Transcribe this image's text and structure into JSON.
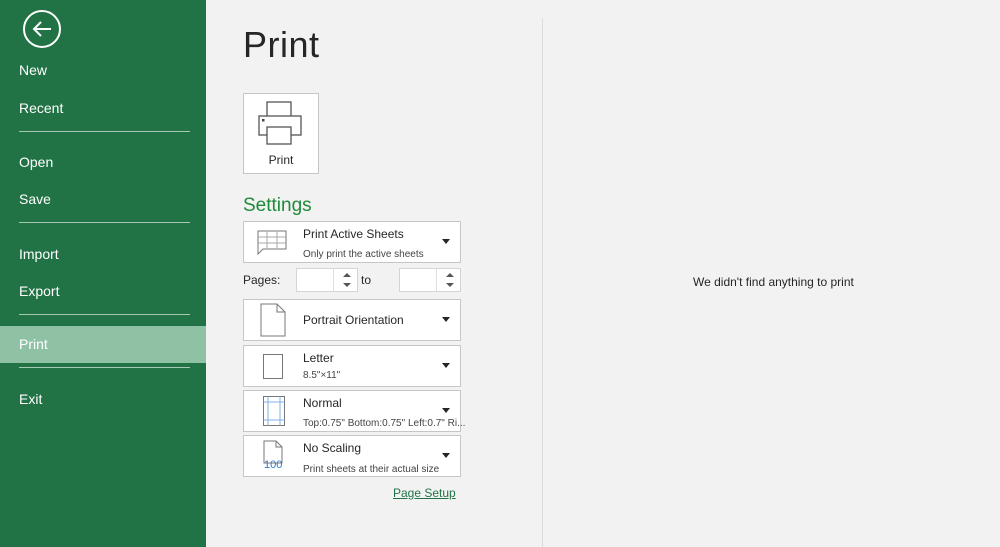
{
  "sidebar": {
    "back_icon": "arrow-left-circle-icon",
    "items": [
      {
        "label": "New"
      },
      {
        "label": "Recent"
      },
      {
        "label": "Open"
      },
      {
        "label": "Save"
      },
      {
        "label": "Import"
      },
      {
        "label": "Export"
      },
      {
        "label": "Print",
        "active": true
      },
      {
        "label": "Exit"
      }
    ]
  },
  "main": {
    "title": "Print",
    "print_button": {
      "label": "Print",
      "icon": "printer-icon"
    },
    "settings_title": "Settings",
    "settings": [
      {
        "title": "Print Active Sheets",
        "subtitle": "Only print the active sheets",
        "icon": "sheet-grid-icon"
      },
      {
        "title": "Portrait Orientation",
        "subtitle": "",
        "icon": "portrait-page-icon"
      },
      {
        "title": "Letter",
        "subtitle": "8.5\"×11\"",
        "icon": "paper-size-icon"
      },
      {
        "title": "Normal",
        "subtitle": "Top:0.75\" Bottom:0.75\" Left:0.7\" Ri...",
        "icon": "margins-icon"
      },
      {
        "title": "No Scaling",
        "subtitle": "Print sheets at their actual size",
        "icon": "scaling-100-icon"
      }
    ],
    "pages": {
      "label": "Pages:",
      "to_label": "to",
      "from_value": "",
      "to_value": ""
    },
    "scaling_icon_text": "100",
    "page_setup_link": "Page Setup",
    "preview_message": "We didn't find anything to print"
  },
  "colors": {
    "accent": "#217346",
    "active_item": "#8fc1a4",
    "settings_green": "#1e8a3a"
  }
}
